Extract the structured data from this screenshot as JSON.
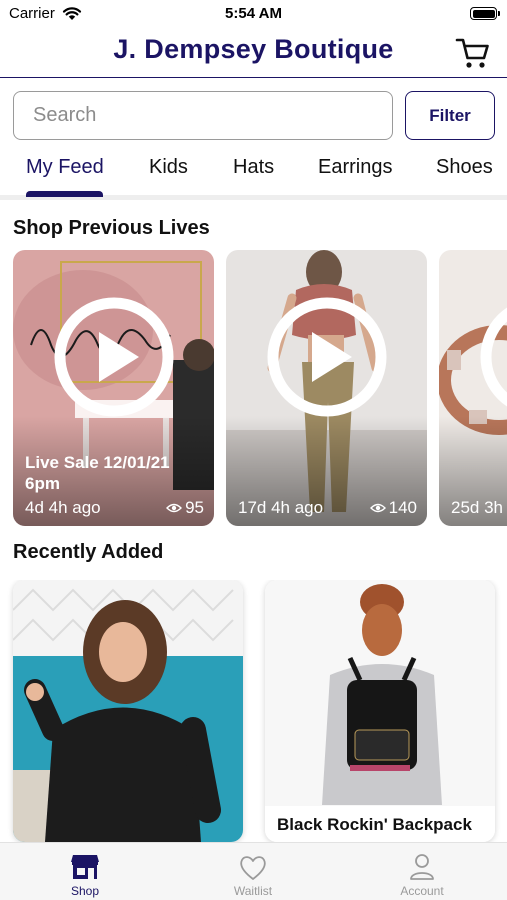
{
  "status_bar": {
    "carrier": "Carrier",
    "time": "5:54 AM"
  },
  "header": {
    "title": "J. Dempsey Boutique",
    "cart_icon": "cart-icon"
  },
  "search": {
    "placeholder": "Search",
    "value": ""
  },
  "filter_label": "Filter",
  "tabs": [
    {
      "label": "My Feed",
      "active": true
    },
    {
      "label": "Kids",
      "active": false
    },
    {
      "label": "Hats",
      "active": false
    },
    {
      "label": "Earrings",
      "active": false
    },
    {
      "label": "Shoes",
      "active": false
    }
  ],
  "previous_lives": {
    "heading": "Shop Previous Lives",
    "items": [
      {
        "title": "Live Sale 12/01/21 6pm",
        "ago": "4d 4h ago",
        "views": "95"
      },
      {
        "title": "",
        "ago": "17d 4h ago",
        "views": "140"
      },
      {
        "title": "",
        "ago": "25d 3h",
        "views": ""
      }
    ]
  },
  "recently_added": {
    "heading": "Recently Added",
    "items": [
      {
        "name": ""
      },
      {
        "name": "Black Rockin' Backpack"
      }
    ]
  },
  "bottom_nav": [
    {
      "label": "Shop",
      "icon": "store-icon",
      "active": true
    },
    {
      "label": "Waitlist",
      "icon": "heart-icon",
      "active": false
    },
    {
      "label": "Account",
      "icon": "person-icon",
      "active": false
    }
  ],
  "colors": {
    "brand": "#1b1464",
    "muted": "#9a9a9a",
    "divider": "#eeeeee"
  }
}
